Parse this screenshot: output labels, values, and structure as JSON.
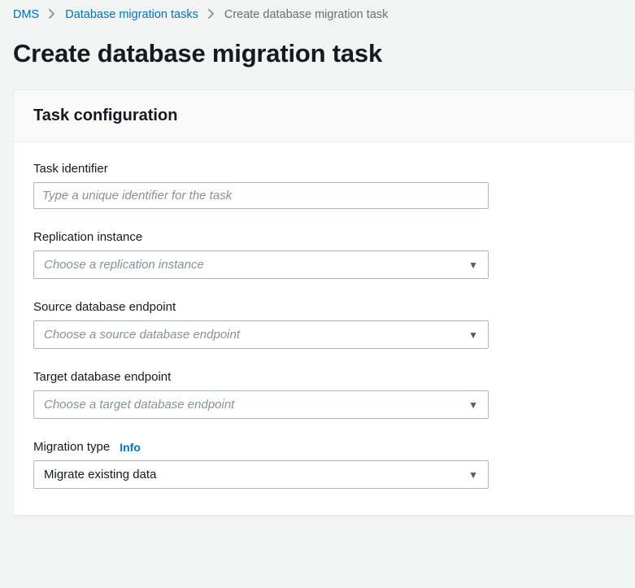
{
  "breadcrumb": {
    "items": [
      {
        "label": "DMS",
        "link": true
      },
      {
        "label": "Database migration tasks",
        "link": true
      },
      {
        "label": "Create database migration task",
        "link": false
      }
    ]
  },
  "page": {
    "title": "Create database migration task"
  },
  "panel": {
    "heading": "Task configuration"
  },
  "fields": {
    "task_identifier": {
      "label": "Task identifier",
      "placeholder": "Type a unique identifier for the task",
      "value": ""
    },
    "replication_instance": {
      "label": "Replication instance",
      "placeholder": "Choose a replication instance",
      "value": ""
    },
    "source_endpoint": {
      "label": "Source database endpoint",
      "placeholder": "Choose a source database endpoint",
      "value": ""
    },
    "target_endpoint": {
      "label": "Target database endpoint",
      "placeholder": "Choose a target database endpoint",
      "value": ""
    },
    "migration_type": {
      "label": "Migration type",
      "info": "Info",
      "value": "Migrate existing data"
    }
  }
}
